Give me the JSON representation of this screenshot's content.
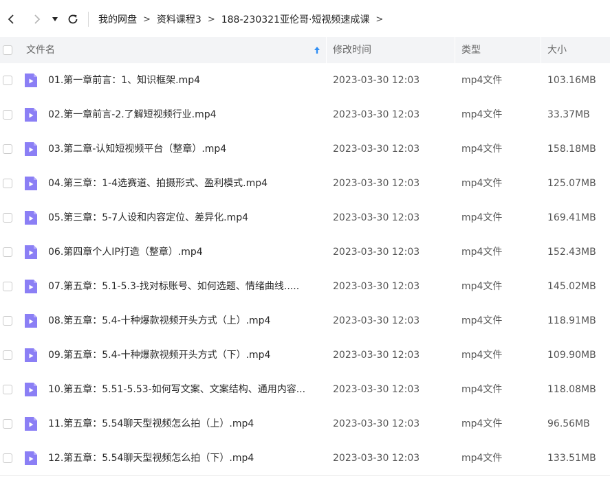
{
  "breadcrumb": {
    "items": [
      "我的网盘",
      "资料课程3",
      "188-230321亚伦哥·短视频速成课"
    ],
    "separator": ">"
  },
  "columns": {
    "name": "文件名",
    "modified": "修改时间",
    "type": "类型",
    "size": "大小"
  },
  "colors": {
    "header_bg": "#f3f4f6",
    "sort_arrow": "#2f8ef4",
    "file_icon": "#8b7ff5"
  },
  "files": [
    {
      "name": "01.第一章前言：1、知识框架.mp4",
      "modified": "2023-03-30 12:03",
      "type": "mp4文件",
      "size": "103.16MB"
    },
    {
      "name": "02.第一章前言-2.了解短视频行业.mp4",
      "modified": "2023-03-30 12:03",
      "type": "mp4文件",
      "size": "33.37MB"
    },
    {
      "name": "03.第二章-认知短视频平台（整章）.mp4",
      "modified": "2023-03-30 12:03",
      "type": "mp4文件",
      "size": "158.18MB"
    },
    {
      "name": "04.第三章：1-4选赛道、拍摄形式、盈利模式.mp4",
      "modified": "2023-03-30 12:03",
      "type": "mp4文件",
      "size": "125.07MB"
    },
    {
      "name": "05.第三章：5-7人设和内容定位、差异化.mp4",
      "modified": "2023-03-30 12:03",
      "type": "mp4文件",
      "size": "169.41MB"
    },
    {
      "name": "06.第四章个人IP打造（整章）.mp4",
      "modified": "2023-03-30 12:03",
      "type": "mp4文件",
      "size": "152.43MB"
    },
    {
      "name": "07.第五章：5.1-5.3-找对标账号、如何选题、情绪曲线.....",
      "modified": "2023-03-30 12:03",
      "type": "mp4文件",
      "size": "145.02MB"
    },
    {
      "name": "08.第五章：5.4-十种爆款视频开头方式（上）.mp4",
      "modified": "2023-03-30 12:03",
      "type": "mp4文件",
      "size": "118.91MB"
    },
    {
      "name": "09.第五章：5.4-十种爆款视频开头方式（下）.mp4",
      "modified": "2023-03-30 12:03",
      "type": "mp4文件",
      "size": "109.90MB"
    },
    {
      "name": "10.第五章：5.51-5.53-如何写文案、文案结构、通用内容...",
      "modified": "2023-03-30 12:03",
      "type": "mp4文件",
      "size": "118.08MB"
    },
    {
      "name": "11.第五章：5.54聊天型视频怎么拍（上）.mp4",
      "modified": "2023-03-30 12:03",
      "type": "mp4文件",
      "size": "96.56MB"
    },
    {
      "name": "12.第五章：5.54聊天型视频怎么拍（下）.mp4",
      "modified": "2023-03-30 12:03",
      "type": "mp4文件",
      "size": "133.51MB"
    }
  ]
}
